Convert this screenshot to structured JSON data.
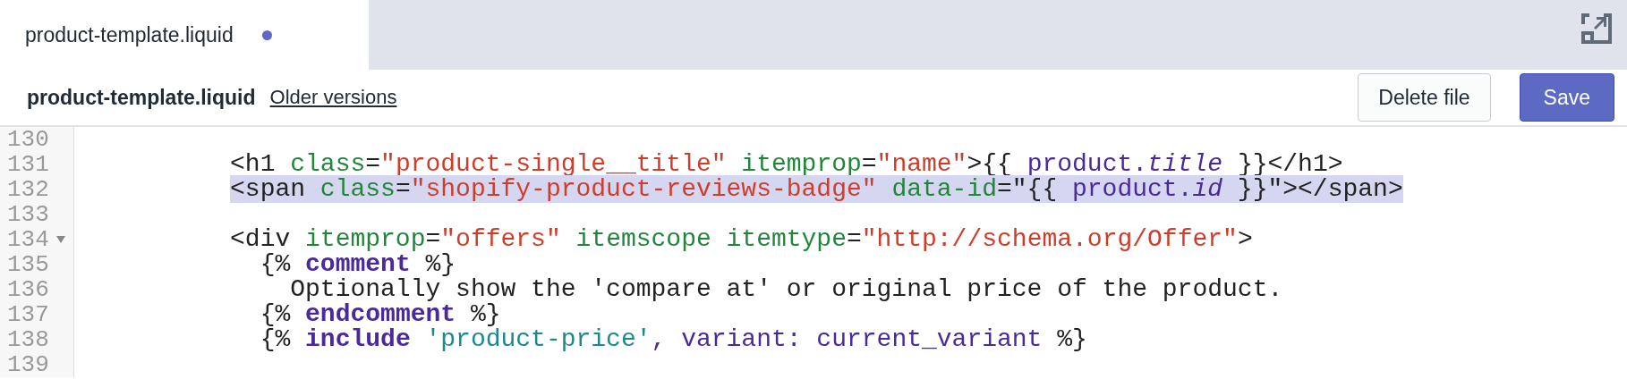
{
  "tab": {
    "label": "product-template.liquid",
    "unsaved": true
  },
  "header": {
    "title": "product-template.liquid",
    "link": "Older versions",
    "buttons": [
      {
        "label": "Delete file",
        "kind": "secondary"
      },
      {
        "label": "Save",
        "kind": "primary"
      }
    ]
  },
  "editor": {
    "lines": [
      {
        "number": "130"
      },
      {
        "number": "131",
        "tokens": [
          {
            "kind": "plain",
            "text": "          <h1"
          },
          {
            "kind": "attr",
            "text": " class"
          },
          {
            "kind": "plain",
            "text": "="
          },
          {
            "kind": "string",
            "text": "\"product-single__title\""
          },
          {
            "kind": "attr",
            "text": " itemprop"
          },
          {
            "kind": "plain",
            "text": "="
          },
          {
            "kind": "string",
            "text": "\"name\""
          },
          {
            "kind": "plain",
            "text": ">{{ "
          },
          {
            "kind": "var",
            "text": "product."
          },
          {
            "kind": "varitalic",
            "text": "title"
          },
          {
            "kind": "plain",
            "text": " }}</h1>"
          }
        ]
      },
      {
        "number": "132",
        "highlighted": true,
        "tokens": [
          {
            "kind": "plain",
            "text": "          <span"
          },
          {
            "kind": "attr",
            "text": " class"
          },
          {
            "kind": "plain",
            "text": "="
          },
          {
            "kind": "string",
            "text": "\"shopify-product-reviews-badge\""
          },
          {
            "kind": "attr",
            "text": " data-id"
          },
          {
            "kind": "plain",
            "text": "=\"{{ "
          },
          {
            "kind": "var",
            "text": "product."
          },
          {
            "kind": "varitalic",
            "text": "id"
          },
          {
            "kind": "plain",
            "text": " }}\"></span>"
          }
        ]
      },
      {
        "number": "133"
      },
      {
        "number": "134",
        "foldable": true,
        "tokens": [
          {
            "kind": "plain",
            "text": "          <div"
          },
          {
            "kind": "attr",
            "text": " itemprop"
          },
          {
            "kind": "plain",
            "text": "="
          },
          {
            "kind": "string",
            "text": "\"offers\""
          },
          {
            "kind": "attr",
            "text": " itemscope"
          },
          {
            "kind": "attr",
            "text": " itemtype"
          },
          {
            "kind": "plain",
            "text": "="
          },
          {
            "kind": "string",
            "text": "\"http://schema.org/Offer\""
          },
          {
            "kind": "plain",
            "text": ">"
          }
        ]
      },
      {
        "number": "135",
        "tokens": [
          {
            "kind": "plain",
            "text": "            {% "
          },
          {
            "kind": "keyword",
            "text": "comment"
          },
          {
            "kind": "plain",
            "text": " %}"
          }
        ]
      },
      {
        "number": "136",
        "tokens": [
          {
            "kind": "plain",
            "text": "              Optionally show the 'compare at' or original price of the product."
          }
        ]
      },
      {
        "number": "137",
        "tokens": [
          {
            "kind": "plain",
            "text": "            {% "
          },
          {
            "kind": "keyword",
            "text": "endcomment"
          },
          {
            "kind": "plain",
            "text": " %}"
          }
        ]
      },
      {
        "number": "138",
        "tokens": [
          {
            "kind": "plain",
            "text": "            {% "
          },
          {
            "kind": "keyword",
            "text": "include"
          },
          {
            "kind": "lstring",
            "text": " 'product-price'"
          },
          {
            "kind": "var",
            "text": ", variant: current_variant"
          },
          {
            "kind": "plain",
            "text": " %}"
          }
        ]
      },
      {
        "number": "139"
      }
    ]
  }
}
